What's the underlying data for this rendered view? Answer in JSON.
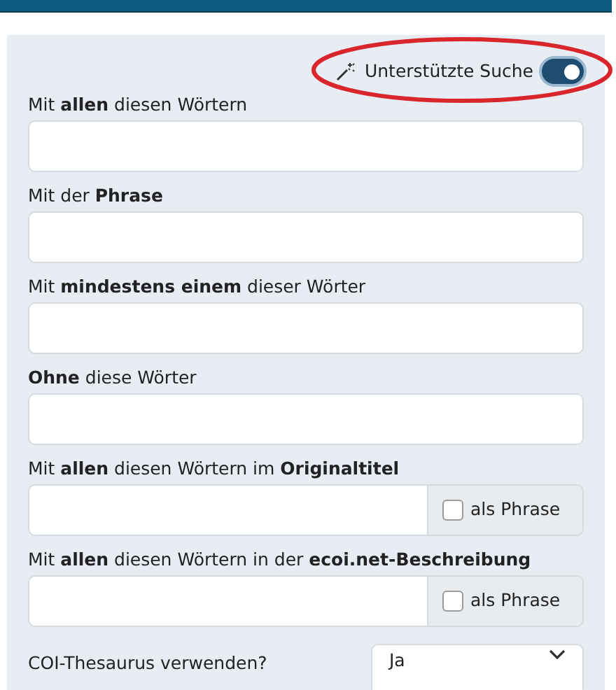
{
  "assisted_search": {
    "label": "Unterstützte Suche",
    "on": true
  },
  "fields": [
    {
      "kind": "plain",
      "label": "Mit **allen** diesen Wörtern"
    },
    {
      "kind": "plain",
      "label": "Mit der **Phrase**"
    },
    {
      "kind": "plain",
      "label": "Mit **mindestens einem** dieser Wörter"
    },
    {
      "kind": "plain",
      "label": "**Ohne** diese Wörter"
    },
    {
      "kind": "phrase",
      "label": "Mit **allen** diesen Wörtern im **Originaltitel**",
      "addon": "als Phrase",
      "checked": false
    },
    {
      "kind": "phrase",
      "label": "Mit **allen** diesen Wörtern in der **ecoi.net-Beschreibung**",
      "addon": "als Phrase",
      "checked": false
    }
  ],
  "thesaurus": {
    "label": "COI-Thesaurus verwenden?",
    "value": "Ja"
  }
}
